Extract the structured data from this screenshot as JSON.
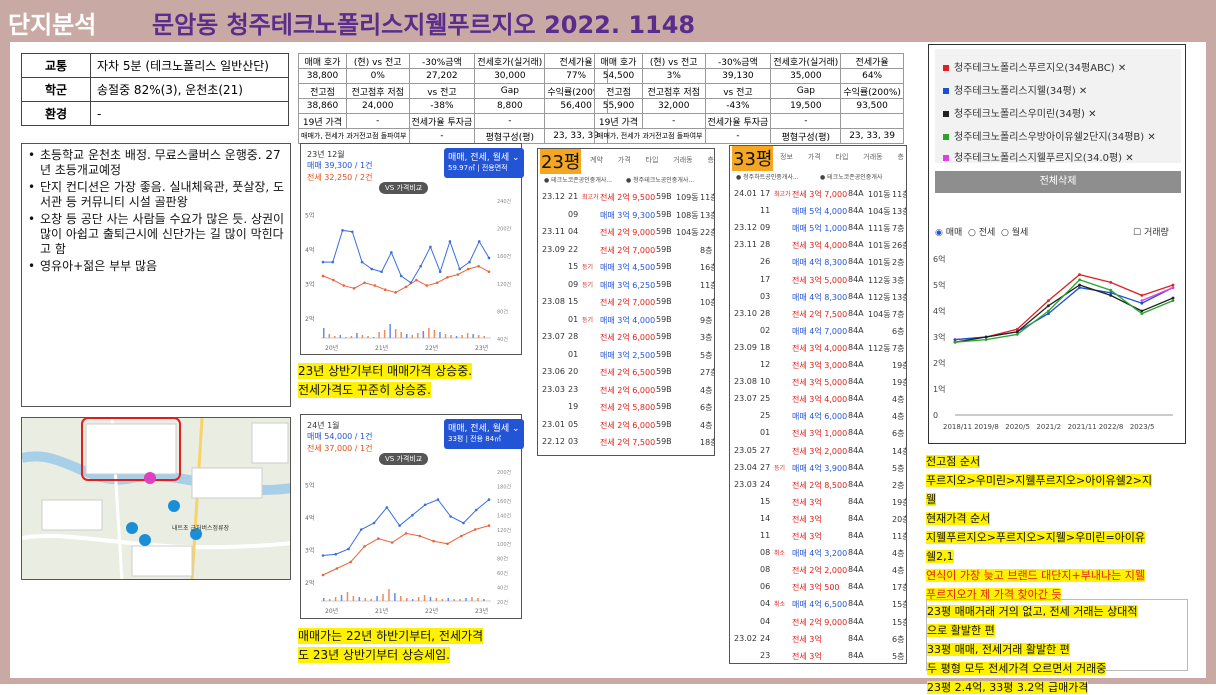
{
  "header": {
    "title_white": "단지분석",
    "title_purple": "문암동 청주테크노폴리스지웰푸르지오 2022. 1148"
  },
  "info": {
    "rows": [
      {
        "k": "교통",
        "v": "자차 5분 (테크노폴리스 일반산단)"
      },
      {
        "k": "학군",
        "v": "송절중 82%(3), 운천초(21)"
      },
      {
        "k": "환경",
        "v": "-"
      }
    ]
  },
  "table1": {
    "r1": [
      "매매 호가",
      "(현) vs 전고",
      "-30%금액",
      "전세호가(실거래)",
      "전세가율"
    ],
    "r2": [
      "38,800",
      "0%",
      "27,202",
      "30,000",
      "77%"
    ],
    "r3": [
      "전고점",
      "전고점후 저점",
      "vs 전고",
      "Gap",
      "수익률(200%)"
    ],
    "r4": [
      "38,860",
      "24,000",
      "-38%",
      "8,800",
      "56,400"
    ],
    "r5": [
      "19년 가격",
      "-",
      "전세가율 투자금",
      "-",
      ""
    ],
    "r6": [
      "매매가, 전세가 과거전고점 돌파여부",
      "-",
      "평형구성(평)",
      "23, 33, 39"
    ]
  },
  "table2": {
    "r1": [
      "매매 호가",
      "(현) vs 전고",
      "-30%금액",
      "전세호가(실거래)",
      "전세가율"
    ],
    "r2": [
      "54,500",
      "3%",
      "39,130",
      "35,000",
      "64%"
    ],
    "r3": [
      "전고점",
      "전고점후 저점",
      "vs 전고",
      "Gap",
      "수익률(200%)"
    ],
    "r4": [
      "55,900",
      "32,000",
      "-43%",
      "19,500",
      "93,500"
    ],
    "r5": [
      "19년 가격",
      "-",
      "전세가율 투자금",
      "-",
      ""
    ],
    "r6": [
      "매매가, 전세가 과거전고점 돌파여부",
      "-",
      "평형구성(평)",
      "23, 33, 39"
    ]
  },
  "bullets": [
    "초등학교 운천초 배정. 무료스쿨버스 운행중. 27년 초등개교예정",
    "단지 컨디션은 가장 좋음. 실내체육관, 풋살장, 도서관 등 커뮤니티 시설 골판왕",
    "오창 등 공단 사는 사람들 수요가 많은 듯. 상권이 많이 아쉽고 출퇴근시에 신단가는 길 많이 막힌다고 함",
    "영유아+젊은 부부 많음"
  ],
  "chart_top": {
    "date": "23년 12월",
    "sale": "매매 39,300 / 1건",
    "jeonse": "전세 32,250 / 2건",
    "chip1": "매매, 전세, 월세 ⌄",
    "chip2": "59.97㎡ | 전용면적",
    "compare": "VS 가격비교",
    "yleft": [
      "5억",
      "4억",
      "3억",
      "2억"
    ],
    "yright": [
      "240건",
      "200건",
      "160건",
      "120건",
      "80건",
      "40건"
    ],
    "xlabels": [
      "20년",
      "21년",
      "22년",
      "23년"
    ]
  },
  "chart_bot": {
    "date": "24년 1월",
    "sale": "매매 54,000 / 1건",
    "jeonse": "전세 37,000 / 1건",
    "chip1": "매매, 전세, 월세 ⌄",
    "chip2": "33평 | 전용 84㎡",
    "compare": "VS 가격비교",
    "yleft": [
      "5억",
      "4억",
      "3억",
      "2억"
    ],
    "yright": [
      "200건",
      "180건",
      "160건",
      "140건",
      "120건",
      "100건",
      "80건",
      "60건",
      "40건",
      "20건"
    ],
    "xlabels": [
      "20년",
      "21년",
      "22년",
      "23년"
    ]
  },
  "note_top": {
    "l1": "23년 상반기부터 매매가격 상승중.",
    "l2": "전세가격도 꾸준히 상승중."
  },
  "note_bot": {
    "l1": "매매가는 22년 하반기부터, 전세가격",
    "l2": "도 23년 상반기부터 상승세임."
  },
  "list23": {
    "title": "23평",
    "head": [
      "계약",
      "가격",
      "타입",
      "거래동",
      "층"
    ],
    "agent1": "테크노코존공인중개사...",
    "agent2": "청주테크노공인중개사...",
    "rows": [
      [
        "23.12",
        "21",
        "최고가",
        "전세 2억 9,500",
        "59B",
        "109동",
        "11층"
      ],
      [
        "",
        "09",
        "",
        "매매 3억 9,300",
        "59B",
        "108동",
        "13층"
      ],
      [
        "23.11",
        "04",
        "",
        "전세 2억 9,000",
        "59B",
        "104동",
        "22층"
      ],
      [
        "23.09",
        "22",
        "",
        "전세 2억 7,000",
        "59B",
        "",
        "8층"
      ],
      [
        "",
        "15",
        "등기",
        "매매 3억 4,500",
        "59B",
        "",
        "16층"
      ],
      [
        "",
        "09",
        "등기",
        "매매 3억 6,250",
        "59B",
        "",
        "11층"
      ],
      [
        "23.08",
        "15",
        "",
        "전세 2억 7,000",
        "59B",
        "",
        "10층"
      ],
      [
        "",
        "01",
        "등기",
        "매매 3억 4,000",
        "59B",
        "",
        "9층"
      ],
      [
        "23.07",
        "28",
        "",
        "전세 2억 6,000",
        "59B",
        "",
        "3층"
      ],
      [
        "",
        "01",
        "",
        "매매 3억 2,500",
        "59B",
        "",
        "5층"
      ],
      [
        "23.06",
        "20",
        "",
        "전세 2억 6,500",
        "59B",
        "",
        "27층"
      ],
      [
        "23.03",
        "23",
        "",
        "전세 2억 6,000",
        "59B",
        "",
        "4층"
      ],
      [
        "",
        "19",
        "",
        "전세 2억 5,800",
        "59B",
        "",
        "6층"
      ],
      [
        "23.01",
        "05",
        "",
        "전세 2억 6,000",
        "59B",
        "",
        "4층"
      ],
      [
        "22.12",
        "03",
        "",
        "전세 2억 7,500",
        "59B",
        "",
        "18층"
      ]
    ]
  },
  "list33": {
    "title": "33평",
    "head": [
      "정보",
      "가격",
      "타입",
      "거래동",
      "층"
    ],
    "agent1": "청주하트공인중개사...",
    "agent2": "테크노코존공인중개사",
    "rows": [
      [
        "24.01",
        "17",
        "최고가",
        "전세 3억 7,000",
        "84A",
        "101동",
        "11층"
      ],
      [
        "",
        "11",
        "",
        "매매 5억 4,000",
        "84A",
        "104동",
        "13층"
      ],
      [
        "23.12",
        "09",
        "",
        "매매 5억 1,000",
        "84A",
        "111동",
        "7층"
      ],
      [
        "23.11",
        "28",
        "",
        "전세 3억 4,000",
        "84A",
        "101동",
        "26층"
      ],
      [
        "",
        "26",
        "",
        "매매 4억 8,300",
        "84A",
        "101동",
        "2층"
      ],
      [
        "",
        "17",
        "",
        "전세 3억 5,000",
        "84A",
        "112동",
        "3층"
      ],
      [
        "",
        "03",
        "",
        "매매 4억 8,300",
        "84A",
        "112동",
        "13층"
      ],
      [
        "23.10",
        "28",
        "",
        "전세 2억 7,500",
        "84A",
        "104동",
        "7층"
      ],
      [
        "",
        "02",
        "",
        "매매 4억 7,000",
        "84A",
        "",
        "6층"
      ],
      [
        "23.09",
        "18",
        "",
        "전세 3억 4,000",
        "84A",
        "112동",
        "7층"
      ],
      [
        "",
        "12",
        "",
        "전세 3억 3,000",
        "84A",
        "",
        "19층"
      ],
      [
        "23.08",
        "10",
        "",
        "전세 3억 5,000",
        "84A",
        "",
        "19층"
      ],
      [
        "23.07",
        "25",
        "",
        "전세 3억 4,000",
        "84A",
        "",
        "4층"
      ],
      [
        "",
        "25",
        "",
        "매매 4억 6,000",
        "84A",
        "",
        "4층"
      ],
      [
        "",
        "01",
        "",
        "전세 3억 1,000",
        "84A",
        "",
        "6층"
      ],
      [
        "23.05",
        "27",
        "",
        "전세 3억 2,000",
        "84A",
        "",
        "14층"
      ],
      [
        "23.04",
        "27",
        "등기",
        "매매 4억 3,900",
        "84A",
        "",
        "5층"
      ],
      [
        "23.03",
        "24",
        "",
        "전세 2억 8,500",
        "84A",
        "",
        "2층"
      ],
      [
        "",
        "15",
        "",
        "전세 3억",
        "84A",
        "",
        "19층"
      ],
      [
        "",
        "14",
        "",
        "전세 3억",
        "84A",
        "",
        "20층"
      ],
      [
        "",
        "11",
        "",
        "전세 3억",
        "84A",
        "",
        "11층"
      ],
      [
        "",
        "08",
        "취소",
        "매매 4억 3,200",
        "84A",
        "",
        "4층"
      ],
      [
        "",
        "08",
        "",
        "전세 2억 2,000",
        "84A",
        "",
        "4층"
      ],
      [
        "",
        "06",
        "",
        "전세 3억 500",
        "84A",
        "",
        "17층"
      ],
      [
        "",
        "04",
        "취소",
        "매매 4억 6,500",
        "84A",
        "",
        "15층"
      ],
      [
        "",
        "04",
        "",
        "전세 2억 9,000",
        "84A",
        "",
        "15층"
      ],
      [
        "23.02",
        "24",
        "",
        "전세 3억",
        "84A",
        "",
        "6층"
      ],
      [
        "",
        "23",
        "",
        "전세 3억",
        "84A",
        "",
        "5층"
      ]
    ]
  },
  "compare": {
    "legend": [
      {
        "name": "청주테크노폴리스푸르지오(34평ABC)",
        "color": "#e02020"
      },
      {
        "name": "청주테크노폴리스지웰(34평)",
        "color": "#1a4fd8"
      },
      {
        "name": "청주테크노폴리스우미린(34평)",
        "color": "#222222"
      },
      {
        "name": "청주테크노폴리스우방아이유쉘2단지(34평B)",
        "color": "#2aa52a"
      },
      {
        "name": "청주테크노폴리스지웰푸르지오(34.0평)",
        "color": "#e040e0"
      }
    ],
    "delete_all": "전체삭제",
    "radios": [
      "매매",
      "전세",
      "월세"
    ],
    "checkbox": "거래량",
    "yticks": [
      "6억",
      "5억",
      "4억",
      "3억",
      "2억",
      "1억",
      "0"
    ],
    "xticks": [
      "2018/11",
      "2019/8",
      "2020/5",
      "2021/2",
      "2021/11",
      "2022/8",
      "2023/5"
    ]
  },
  "chart_data": {
    "type": "line",
    "title": "",
    "xlabel": "",
    "ylabel": "",
    "ylim": [
      0,
      6
    ],
    "x": [
      "2018/11",
      "2019/8",
      "2020/5",
      "2021/2",
      "2021/11",
      "2022/8",
      "2023/5",
      "2023/12"
    ],
    "series": [
      {
        "name": "청주테크노폴리스푸르지오(34평ABC)",
        "values": [
          2.9,
          3.0,
          3.3,
          4.4,
          5.4,
          5.1,
          4.6,
          5.0
        ]
      },
      {
        "name": "청주테크노폴리스지웰(34평)",
        "values": [
          2.9,
          3.0,
          3.2,
          3.9,
          4.9,
          4.7,
          4.3,
          4.9
        ]
      },
      {
        "name": "청주테크노폴리스우미린(34평)",
        "values": [
          2.8,
          3.0,
          3.2,
          4.2,
          5.0,
          4.6,
          4.0,
          4.5
        ]
      },
      {
        "name": "청주테크노폴리스우방아이유쉘2단지(34평B)",
        "values": [
          2.8,
          2.9,
          3.1,
          4.0,
          5.2,
          4.8,
          3.9,
          4.4
        ]
      },
      {
        "name": "청주테크노폴리스지웰푸르지오(34.0평)",
        "values": [
          null,
          null,
          null,
          null,
          null,
          null,
          4.4,
          4.9
        ]
      }
    ]
  },
  "notes_right": {
    "h1": "전고점 순서",
    "t1a": "푸르지오>우미린>지웰푸르지오>아이유쉘2>지",
    "t1b": "웰",
    "h2": "현재가격 순서",
    "t2a": "지웰푸르지오>푸르지오>지웰>우미린=아이유",
    "t2b": "쉘2,1",
    "t3a": "연식이 가장 늦고 브랜드 대단지+부내나는 지웰",
    "t3b": "푸르지오가 제 가격 찾아간 듯",
    "t4a": "23평 매매거래 거의 없고, 전세 거래는 상대적",
    "t4b": "으로 활발한 편",
    "t4c": "33평 매매, 전세거래 활발한 편",
    "t4d": "두 평형 모두 전세가격 오르면서 거래중",
    "t4e": "23평 2.4억, 33평 3.2억 급매가격"
  },
  "map": {
    "label": "내트초 근처버스정류장"
  }
}
